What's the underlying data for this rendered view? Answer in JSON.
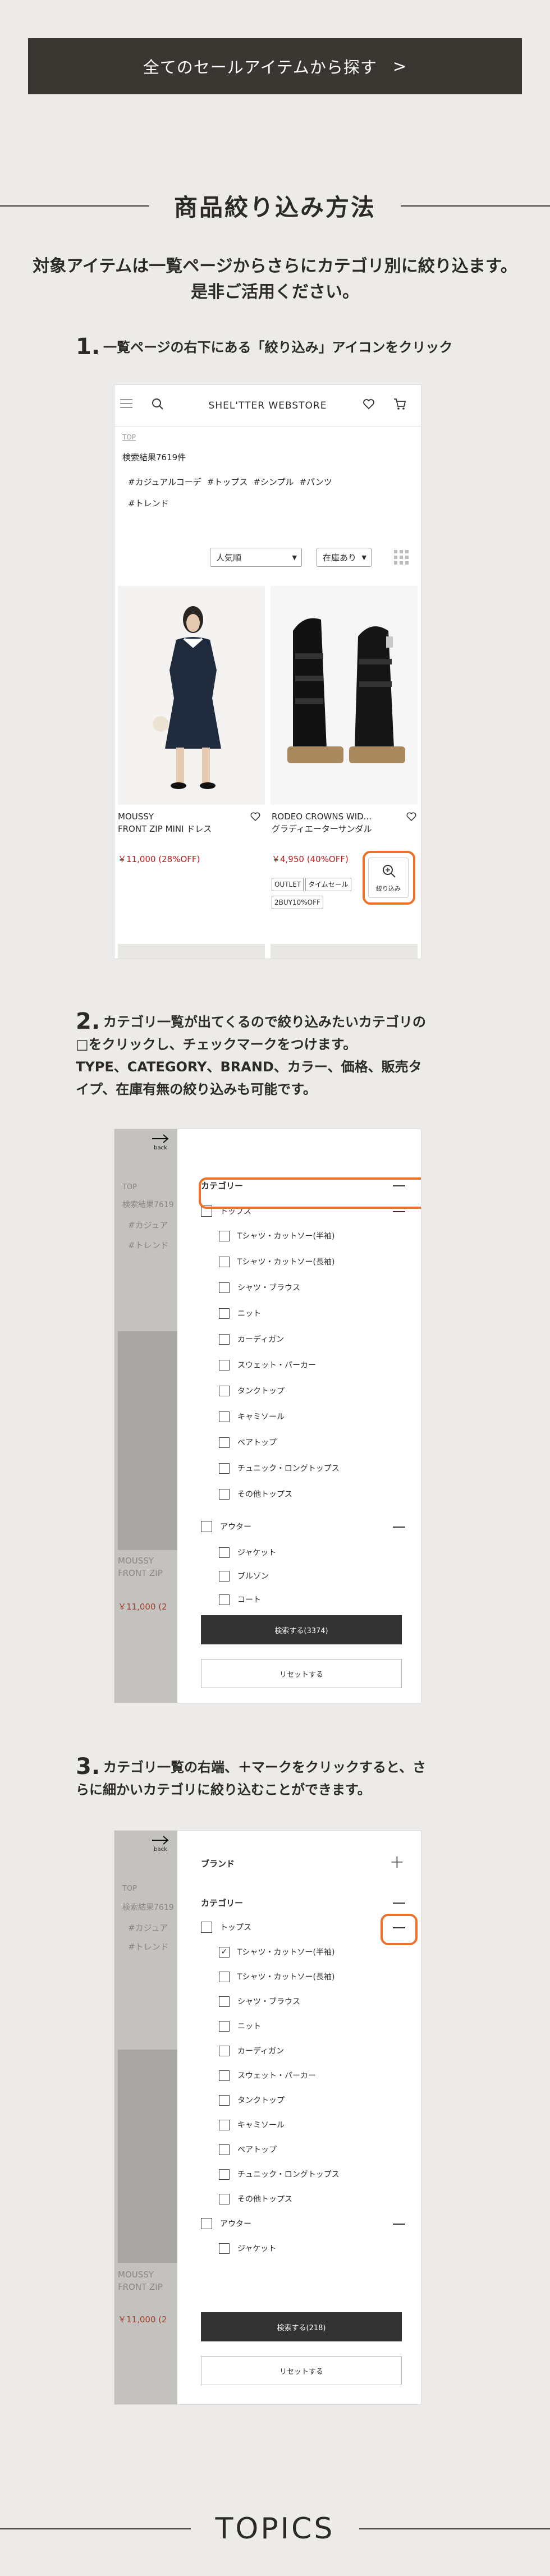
{
  "banner": {
    "label": "全てのセールアイテムから探す",
    "arrow": ">"
  },
  "heading": "商品絞り込み方法",
  "lead": [
    "対象アイテムは一覧ページからさらにカテゴリ別に絞り込ます。",
    "是非ご活用ください。"
  ],
  "steps": [
    {
      "num": "1.",
      "lines": [
        "一覧ページの右下にある「絞り込み」アイコンをクリック"
      ]
    },
    {
      "num": "2.",
      "lines": [
        "カテゴリ一覧が出てくるので絞り込みたいカテゴリの",
        "□をクリックし、チェックマークをつけます。",
        "TYPE、CATEGORY、BRAND、カラー、価格、販売タ",
        "イプ、在庫有無の絞り込みも可能です。"
      ]
    },
    {
      "num": "3.",
      "lines": [
        "カテゴリ一覧の右端、＋マークをクリックすると、さ",
        "らに細かいカテゴリに絞り込むことができます。"
      ]
    }
  ],
  "shot1": {
    "logo": "SHEL'TTER WEBSTORE",
    "breadcrumb": "TOP",
    "result": "検索結果7619件",
    "tags": [
      "#カジュアルコーデ",
      "#トップス",
      "#シンプル",
      "#パンツ",
      "#トレンド"
    ],
    "sort": "人気順",
    "stock": "在庫あり",
    "products": [
      {
        "brand": "MOUSSY",
        "name": "FRONT ZIP MINI ドレス",
        "price": "￥11,000 (28%OFF)"
      },
      {
        "brand": "RODEO CROWNS WID...",
        "name": "グラディエーターサンダル",
        "price": "￥4,950 (40%OFF)",
        "chips": [
          "OUTLET",
          "タイムセール",
          "2BUY10%OFF"
        ]
      }
    ],
    "filter_label": "絞り込み"
  },
  "shot2": {
    "back": "back",
    "section": "カテゴリー",
    "groups": [
      {
        "label": "トップス",
        "items": [
          "Tシャツ・カットソー(半袖)",
          "Tシャツ・カットソー(長袖)",
          "シャツ・ブラウス",
          "ニット",
          "カーディガン",
          "スウェット・パーカー",
          "タンクトップ",
          "キャミソール",
          "ベアトップ",
          "チュニック・ロングトップス",
          "その他トップス"
        ]
      },
      {
        "label": "アウター",
        "items": [
          "ジャケット",
          "ブルゾン",
          "コート"
        ]
      }
    ],
    "search_btn": "検索する(3374)",
    "reset_btn": "リセットする",
    "ghost": {
      "result": "検索結果7619",
      "tag1": "#カジュア",
      "tag2": "#トレンド",
      "brand": "MOUSSY",
      "name": "FRONT ZIP",
      "price": "￥11,000 (2"
    }
  },
  "shot3": {
    "back": "back",
    "brand": "ブランド",
    "plus": "+",
    "section": "カテゴリー",
    "groups": [
      {
        "label": "トップス",
        "items": [
          "Tシャツ・カットソー(半袖)",
          "Tシャツ・カットソー(長袖)",
          "シャツ・ブラウス",
          "ニット",
          "カーディガン",
          "スウェット・パーカー",
          "タンクトップ",
          "キャミソール",
          "ベアトップ",
          "チュニック・ロングトップス",
          "その他トップス"
        ],
        "checked": [
          0
        ]
      },
      {
        "label": "アウター",
        "items": [
          "ジャケット"
        ]
      }
    ],
    "search_btn": "検索する(218)",
    "reset_btn": "リセットする",
    "ghost": {
      "result": "検索結果7619",
      "tag1": "#カジュア",
      "tag2": "#トレンド",
      "brand": "MOUSSY",
      "name": "FRONT ZIP",
      "price": "￥11,000 (2"
    }
  },
  "footer": "TOPICS"
}
